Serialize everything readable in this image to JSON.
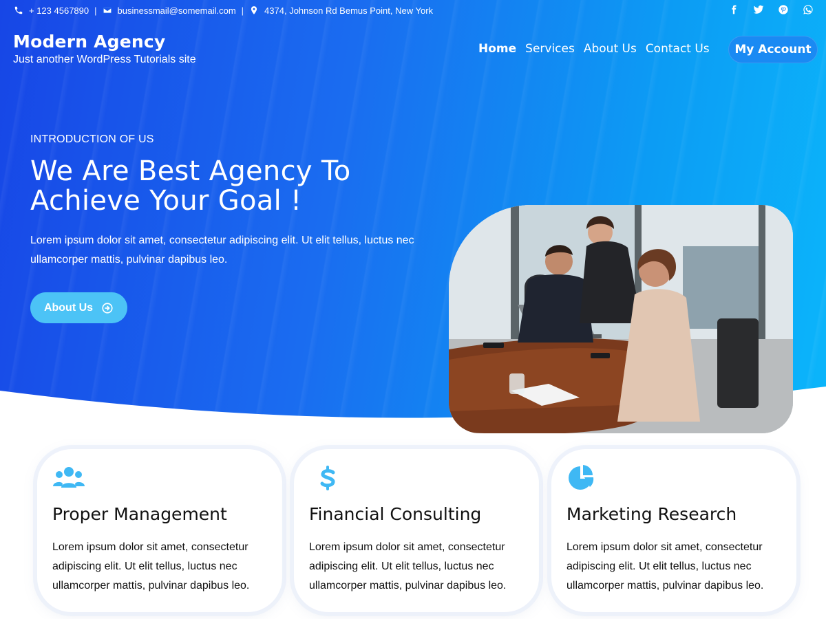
{
  "topbar": {
    "phone": "+ 123 4567890",
    "email": "businessmail@somemail.com",
    "address": "4374, Johnson Rd Bemus Point, New York",
    "separator": "|",
    "social_icons": [
      "facebook-icon",
      "twitter-icon",
      "pinterest-icon",
      "whatsapp-icon"
    ]
  },
  "header": {
    "site_name": "Modern Agency",
    "tagline": "Just another WordPress Tutorials site",
    "nav": [
      "Home",
      "Services",
      "About Us",
      "Contact Us"
    ],
    "account_button": "My Account"
  },
  "hero": {
    "eyebrow": "INTRODUCTION OF US",
    "headline_line1": "We Are Best Agency To",
    "headline_line2": "Achieve Your Goal !",
    "body": "Lorem ipsum dolor sit amet, consectetur adipiscing elit. Ut elit tellus, luctus nec ullamcorper mattis, pulvinar dapibus leo.",
    "button_label": "About Us"
  },
  "features": [
    {
      "icon": "team-icon",
      "title": "Proper Management",
      "text": "Lorem ipsum dolor sit amet, consectetur adipiscing elit. Ut elit tellus, luctus nec ullamcorper mattis, pulvinar dapibus leo."
    },
    {
      "icon": "dollar-icon",
      "title": "Financial Consulting",
      "text": "Lorem ipsum dolor sit amet, consectetur adipiscing elit. Ut elit tellus, luctus nec ullamcorper mattis, pulvinar dapibus leo."
    },
    {
      "icon": "pie-chart-icon",
      "title": "Marketing Research",
      "text": "Lorem ipsum dolor sit amet, consectetur adipiscing elit. Ut elit tellus, luctus nec ullamcorper mattis, pulvinar dapibus leo."
    }
  ],
  "colors": {
    "hero_start": "#1746e6",
    "hero_end": "#0bb6fb",
    "accent_light": "#4cc3f6",
    "icon_color": "#3fb8f4"
  }
}
